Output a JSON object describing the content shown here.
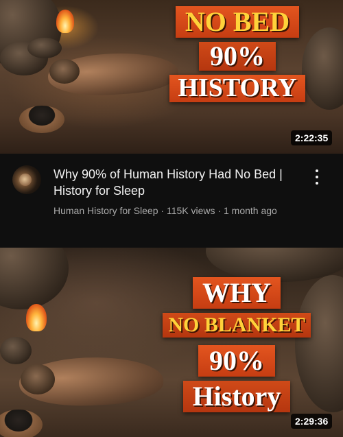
{
  "videos": [
    {
      "thumbnail": {
        "lines": [
          "NO BED",
          "90%",
          "HISTORY"
        ],
        "duration": "2:22:35"
      },
      "title": "Why 90% of Human History Had No Bed | History for Sleep",
      "channel": "Human History for Sleep",
      "views": "115K views",
      "age": "1 month ago",
      "separator": "·",
      "menu_icon": "more-vert-icon"
    },
    {
      "thumbnail": {
        "lines": [
          "WHY",
          "NO BLANKET",
          "90%",
          "History"
        ],
        "duration": "2:29:36"
      }
    }
  ],
  "colors": {
    "background": "#0f0f0f",
    "text_primary": "#f1f1f1",
    "text_secondary": "#aaaaaa",
    "banner_orange": "#d9481a",
    "banner_yellow_text": "#ffd23a"
  }
}
